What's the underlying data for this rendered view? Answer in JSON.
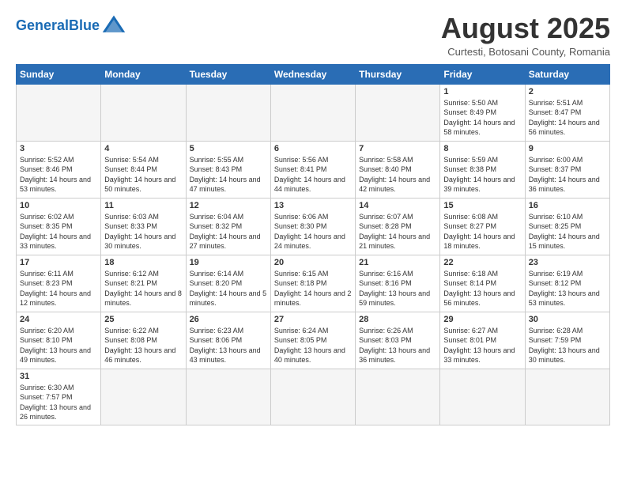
{
  "header": {
    "logo_general": "General",
    "logo_blue": "Blue",
    "title": "August 2025",
    "subtitle": "Curtesti, Botosani County, Romania"
  },
  "days_of_week": [
    "Sunday",
    "Monday",
    "Tuesday",
    "Wednesday",
    "Thursday",
    "Friday",
    "Saturday"
  ],
  "weeks": [
    [
      {
        "day": "",
        "info": ""
      },
      {
        "day": "",
        "info": ""
      },
      {
        "day": "",
        "info": ""
      },
      {
        "day": "",
        "info": ""
      },
      {
        "day": "",
        "info": ""
      },
      {
        "day": "1",
        "info": "Sunrise: 5:50 AM\nSunset: 8:49 PM\nDaylight: 14 hours and 58 minutes."
      },
      {
        "day": "2",
        "info": "Sunrise: 5:51 AM\nSunset: 8:47 PM\nDaylight: 14 hours and 56 minutes."
      }
    ],
    [
      {
        "day": "3",
        "info": "Sunrise: 5:52 AM\nSunset: 8:46 PM\nDaylight: 14 hours and 53 minutes."
      },
      {
        "day": "4",
        "info": "Sunrise: 5:54 AM\nSunset: 8:44 PM\nDaylight: 14 hours and 50 minutes."
      },
      {
        "day": "5",
        "info": "Sunrise: 5:55 AM\nSunset: 8:43 PM\nDaylight: 14 hours and 47 minutes."
      },
      {
        "day": "6",
        "info": "Sunrise: 5:56 AM\nSunset: 8:41 PM\nDaylight: 14 hours and 44 minutes."
      },
      {
        "day": "7",
        "info": "Sunrise: 5:58 AM\nSunset: 8:40 PM\nDaylight: 14 hours and 42 minutes."
      },
      {
        "day": "8",
        "info": "Sunrise: 5:59 AM\nSunset: 8:38 PM\nDaylight: 14 hours and 39 minutes."
      },
      {
        "day": "9",
        "info": "Sunrise: 6:00 AM\nSunset: 8:37 PM\nDaylight: 14 hours and 36 minutes."
      }
    ],
    [
      {
        "day": "10",
        "info": "Sunrise: 6:02 AM\nSunset: 8:35 PM\nDaylight: 14 hours and 33 minutes."
      },
      {
        "day": "11",
        "info": "Sunrise: 6:03 AM\nSunset: 8:33 PM\nDaylight: 14 hours and 30 minutes."
      },
      {
        "day": "12",
        "info": "Sunrise: 6:04 AM\nSunset: 8:32 PM\nDaylight: 14 hours and 27 minutes."
      },
      {
        "day": "13",
        "info": "Sunrise: 6:06 AM\nSunset: 8:30 PM\nDaylight: 14 hours and 24 minutes."
      },
      {
        "day": "14",
        "info": "Sunrise: 6:07 AM\nSunset: 8:28 PM\nDaylight: 14 hours and 21 minutes."
      },
      {
        "day": "15",
        "info": "Sunrise: 6:08 AM\nSunset: 8:27 PM\nDaylight: 14 hours and 18 minutes."
      },
      {
        "day": "16",
        "info": "Sunrise: 6:10 AM\nSunset: 8:25 PM\nDaylight: 14 hours and 15 minutes."
      }
    ],
    [
      {
        "day": "17",
        "info": "Sunrise: 6:11 AM\nSunset: 8:23 PM\nDaylight: 14 hours and 12 minutes."
      },
      {
        "day": "18",
        "info": "Sunrise: 6:12 AM\nSunset: 8:21 PM\nDaylight: 14 hours and 8 minutes."
      },
      {
        "day": "19",
        "info": "Sunrise: 6:14 AM\nSunset: 8:20 PM\nDaylight: 14 hours and 5 minutes."
      },
      {
        "day": "20",
        "info": "Sunrise: 6:15 AM\nSunset: 8:18 PM\nDaylight: 14 hours and 2 minutes."
      },
      {
        "day": "21",
        "info": "Sunrise: 6:16 AM\nSunset: 8:16 PM\nDaylight: 13 hours and 59 minutes."
      },
      {
        "day": "22",
        "info": "Sunrise: 6:18 AM\nSunset: 8:14 PM\nDaylight: 13 hours and 56 minutes."
      },
      {
        "day": "23",
        "info": "Sunrise: 6:19 AM\nSunset: 8:12 PM\nDaylight: 13 hours and 53 minutes."
      }
    ],
    [
      {
        "day": "24",
        "info": "Sunrise: 6:20 AM\nSunset: 8:10 PM\nDaylight: 13 hours and 49 minutes."
      },
      {
        "day": "25",
        "info": "Sunrise: 6:22 AM\nSunset: 8:08 PM\nDaylight: 13 hours and 46 minutes."
      },
      {
        "day": "26",
        "info": "Sunrise: 6:23 AM\nSunset: 8:06 PM\nDaylight: 13 hours and 43 minutes."
      },
      {
        "day": "27",
        "info": "Sunrise: 6:24 AM\nSunset: 8:05 PM\nDaylight: 13 hours and 40 minutes."
      },
      {
        "day": "28",
        "info": "Sunrise: 6:26 AM\nSunset: 8:03 PM\nDaylight: 13 hours and 36 minutes."
      },
      {
        "day": "29",
        "info": "Sunrise: 6:27 AM\nSunset: 8:01 PM\nDaylight: 13 hours and 33 minutes."
      },
      {
        "day": "30",
        "info": "Sunrise: 6:28 AM\nSunset: 7:59 PM\nDaylight: 13 hours and 30 minutes."
      }
    ],
    [
      {
        "day": "31",
        "info": "Sunrise: 6:30 AM\nSunset: 7:57 PM\nDaylight: 13 hours and 26 minutes."
      },
      {
        "day": "",
        "info": ""
      },
      {
        "day": "",
        "info": ""
      },
      {
        "day": "",
        "info": ""
      },
      {
        "day": "",
        "info": ""
      },
      {
        "day": "",
        "info": ""
      },
      {
        "day": "",
        "info": ""
      }
    ]
  ]
}
